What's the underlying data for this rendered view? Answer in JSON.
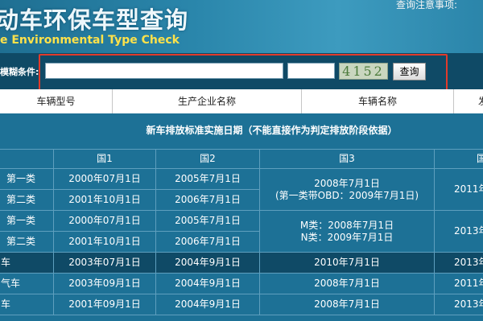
{
  "header": {
    "title_cn": "动车环保车型查询",
    "title_en": "e Environmental Type Check",
    "notice": "查询注意事项:"
  },
  "search": {
    "label": "模糊条件:",
    "query_value": "",
    "code_value": "",
    "captcha": "4152",
    "button": "查询"
  },
  "columns": [
    "车辆型号",
    "生产企业名称",
    "车辆名称",
    "发"
  ],
  "standards": {
    "title": "新车排放标准实施日期（不能直接作为判定排放阶段依据）",
    "headers": [
      "国1",
      "国2",
      "国3",
      "国"
    ],
    "rows": [
      {
        "label": "第一类",
        "g1": "2000年07月1日",
        "g2": "2005年7月1日"
      },
      {
        "label": "第二类",
        "g1": "2001年10月1日",
        "g2": "2006年7月1日"
      },
      {
        "label": "第一类",
        "g1": "2000年07月1日",
        "g2": "2005年7月1日"
      },
      {
        "label": "第二类",
        "g1": "2001年10月1日",
        "g2": "2006年7月1日"
      },
      {
        "label": "车",
        "g1": "2003年07月1日",
        "g2": "2004年9月1日",
        "g3": "2010年7月1日",
        "g4": "2013年"
      },
      {
        "label": "气车",
        "g1": "2003年09月1日",
        "g2": "2004年9月1日",
        "g3": "2008年7月1日",
        "g4": "2011年"
      },
      {
        "label": "车",
        "g1": "2001年09月1日",
        "g2": "2004年9月1日",
        "g3": "2008年7月1日",
        "g4": "2013年"
      }
    ],
    "merged": {
      "g3_a_line1": "2008年7月1日",
      "g3_a_line2": "(第一类带OBD：2009年7月1日)",
      "g4_a": "2011年",
      "g3_b_line1": "M类：2008年7月1日",
      "g3_b_line2": "N类：2009年7月1日",
      "g4_b": "2013年"
    }
  }
}
